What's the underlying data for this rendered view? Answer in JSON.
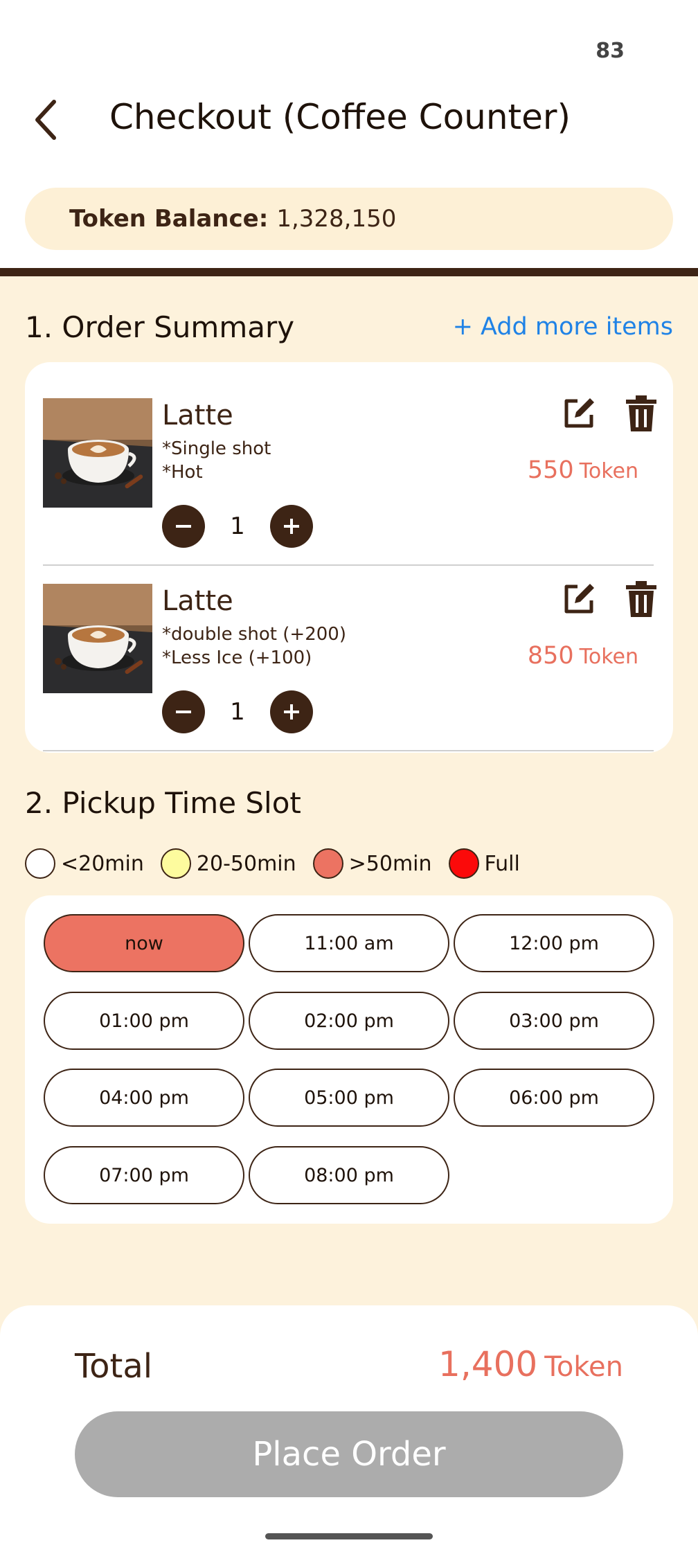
{
  "status": {
    "battery": "83"
  },
  "header": {
    "title": "Checkout (Coffee Counter)",
    "back_icon": "chevron-left-icon"
  },
  "token_balance": {
    "label": "Token Balance:",
    "value": "1,328,150"
  },
  "order_summary": {
    "title": "1. Order Summary",
    "add_more_label": "+ Add more items",
    "items": [
      {
        "name": "Latte",
        "options": [
          "*Single shot",
          "*Hot"
        ],
        "price": "550",
        "unit": "Token",
        "quantity": "1"
      },
      {
        "name": "Latte",
        "options": [
          "*double shot (+200)",
          "*Less Ice (+100)"
        ],
        "price": "850",
        "unit": "Token",
        "quantity": "1"
      }
    ]
  },
  "pickup": {
    "title": "2. Pickup Time Slot",
    "legend": [
      {
        "label": "<20min",
        "color": "#ffffff"
      },
      {
        "label": "20-50min",
        "color": "#fdfb9e"
      },
      {
        "label": ">50min",
        "color": "#ec7362"
      },
      {
        "label": "Full",
        "color": "#fb0a0a"
      }
    ],
    "slots": [
      "now",
      "11:00 am",
      "12:00 pm",
      "01:00 pm",
      "02:00 pm",
      "03:00 pm",
      "04:00 pm",
      "05:00 pm",
      "06:00 pm",
      "07:00 pm",
      "08:00 pm"
    ],
    "selected": "now"
  },
  "footer": {
    "total_label": "Total",
    "total_value": "1,400",
    "total_unit": "Token",
    "place_order_label": "Place Order"
  }
}
